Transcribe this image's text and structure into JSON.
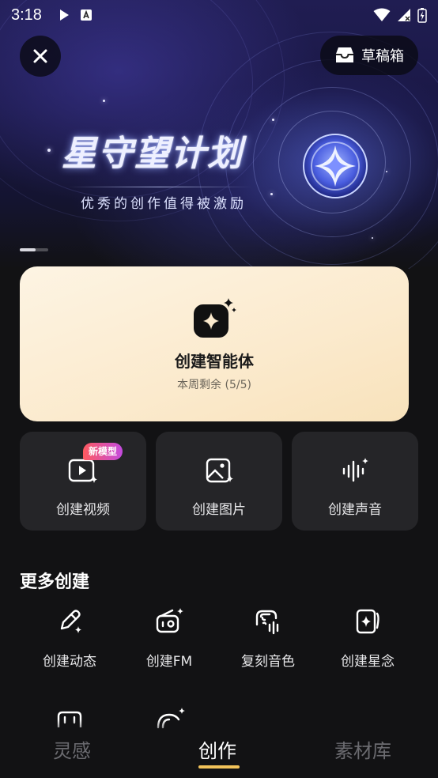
{
  "status_bar": {
    "time": "3:18"
  },
  "header": {
    "drafts_label": "草稿箱"
  },
  "banner": {
    "title": "星守望计划",
    "subtitle": "优秀的创作值得被激励"
  },
  "agent_card": {
    "title": "创建智能体",
    "subtitle": "本周剩余 (5/5)"
  },
  "tiles": [
    {
      "label": "创建视频",
      "badge": "新模型"
    },
    {
      "label": "创建图片"
    },
    {
      "label": "创建声音"
    }
  ],
  "more": {
    "title": "更多创建",
    "items": [
      {
        "label": "创建动态"
      },
      {
        "label": "创建FM"
      },
      {
        "label": "复刻音色"
      },
      {
        "label": "创建星念"
      }
    ]
  },
  "bottom_nav": {
    "items": [
      {
        "label": "灵感"
      },
      {
        "label": "创作"
      },
      {
        "label": "素材库"
      }
    ],
    "active": "创作",
    "accent_color": "#f2c35a"
  },
  "colors": {
    "card_bg": "#fbeacd",
    "tile_bg": "#252528",
    "page_bg": "#121214"
  }
}
